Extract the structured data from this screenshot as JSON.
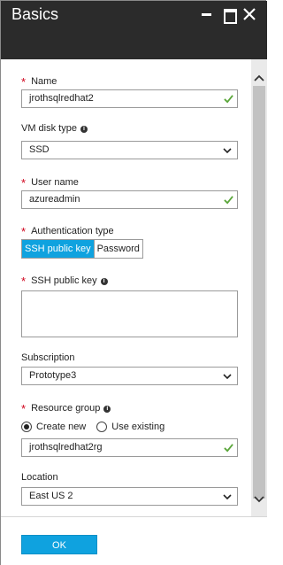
{
  "window": {
    "title": "Basics",
    "minimize_icon": "minimize-icon",
    "maximize_icon": "maximize-icon",
    "close_icon": "close-icon"
  },
  "form": {
    "name": {
      "label": "Name",
      "value": "jrothsqlredhat2",
      "valid": true
    },
    "vm_disk_type": {
      "label": "VM disk type",
      "value": "SSD"
    },
    "user_name": {
      "label": "User name",
      "value": "azureadmin",
      "valid": true
    },
    "authentication_type": {
      "label": "Authentication type",
      "options": [
        "SSH public key",
        "Password"
      ],
      "selected": "SSH public key"
    },
    "ssh_public_key": {
      "label": "SSH public key",
      "value": ""
    },
    "subscription": {
      "label": "Subscription",
      "value": "Prototype3"
    },
    "resource_group": {
      "label": "Resource group",
      "create_new_label": "Create new",
      "use_existing_label": "Use existing",
      "selected": "Create new",
      "value": "jrothsqlredhat2rg",
      "valid": true
    },
    "location": {
      "label": "Location",
      "value": "East US 2"
    }
  },
  "footer": {
    "ok_label": "OK"
  },
  "colors": {
    "accent": "#0fa2df",
    "header_bg": "#2b2b2b",
    "required": "#d0021b",
    "valid": "#5aa63a"
  }
}
